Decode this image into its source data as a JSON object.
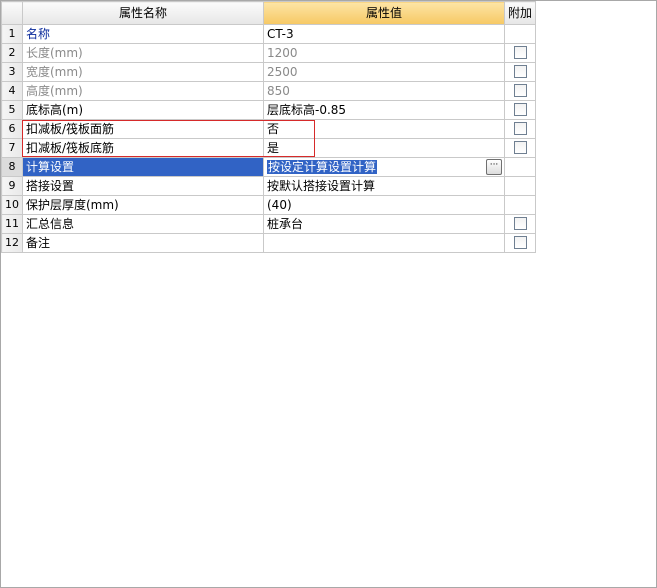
{
  "columns": {
    "name_header": "属性名称",
    "value_header": "属性值",
    "extra_header": "附加"
  },
  "rows": [
    {
      "index": "1",
      "name": "名称",
      "value": "CT-3",
      "has_checkbox": false
    },
    {
      "index": "2",
      "name": "长度(mm)",
      "value": "1200",
      "has_checkbox": true
    },
    {
      "index": "3",
      "name": "宽度(mm)",
      "value": "2500",
      "has_checkbox": true
    },
    {
      "index": "4",
      "name": "高度(mm)",
      "value": "850",
      "has_checkbox": true
    },
    {
      "index": "5",
      "name": "底标高(m)",
      "value": "层底标高-0.85",
      "has_checkbox": true
    },
    {
      "index": "6",
      "name": "扣减板/筏板面筋",
      "value": "否",
      "has_checkbox": true
    },
    {
      "index": "7",
      "name": "扣减板/筏板底筋",
      "value": "是",
      "has_checkbox": true
    },
    {
      "index": "8",
      "name": "计算设置",
      "value": "按设定计算设置计算",
      "has_checkbox": false
    },
    {
      "index": "9",
      "name": "搭接设置",
      "value": "按默认搭接设置计算",
      "has_checkbox": false
    },
    {
      "index": "10",
      "name": "保护层厚度(mm)",
      "value": "(40)",
      "has_checkbox": false
    },
    {
      "index": "11",
      "name": "汇总信息",
      "value": "桩承台",
      "has_checkbox": true
    },
    {
      "index": "12",
      "name": "备注",
      "value": "",
      "has_checkbox": true
    }
  ],
  "ellipsis_button_label": "···"
}
